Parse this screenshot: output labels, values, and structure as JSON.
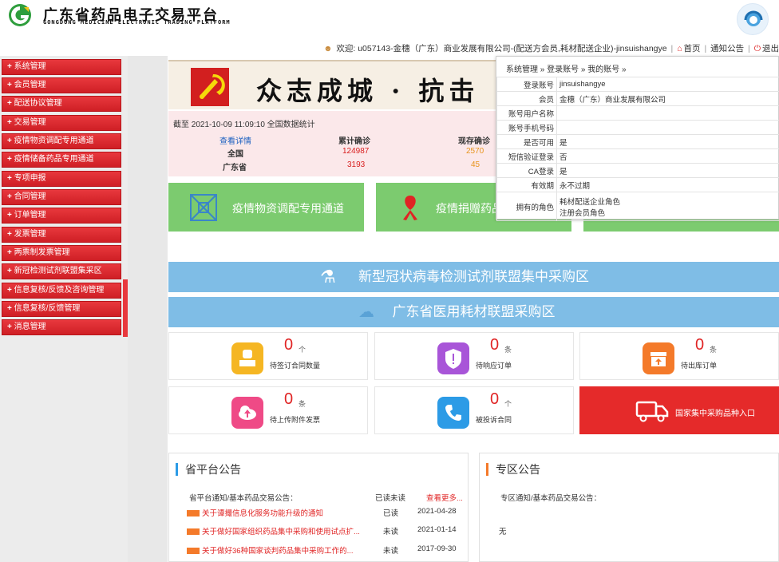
{
  "header": {
    "title": "广东省药品电子交易平台",
    "subtitle": "GONGDONG MEDICINE ELECTRONIC TRADING PLATFORM",
    "welcome": "欢迎: u057143-金穗（广东）商业发展有限公司-(配送方会员,耗材配送企业)-jinsuishangye",
    "home": "首页",
    "notice": "通知公告",
    "logout": "退出"
  },
  "sidebar": {
    "items": [
      {
        "label": "系统管理"
      },
      {
        "label": "会员管理"
      },
      {
        "label": "配送协议管理"
      },
      {
        "label": "交易管理"
      },
      {
        "label": "疫情物资调配专用通道"
      },
      {
        "label": "疫情储备药品专用通道"
      },
      {
        "label": "专项申报"
      },
      {
        "label": "合同管理"
      },
      {
        "label": "订单管理"
      },
      {
        "label": "发票管理"
      },
      {
        "label": "两票制发票管理"
      },
      {
        "label": "新冠检测试剂联盟集采区"
      },
      {
        "label": "信息复核/反馈及咨询管理"
      },
      {
        "label": "信息复核/反馈管理"
      },
      {
        "label": "消息管理"
      }
    ]
  },
  "banner": {
    "text": "众志成城 · 抗击"
  },
  "stats": {
    "as_of": "截至 2021-10-09 11:09:10 全国数据统计",
    "detail_link": "查看详情",
    "col_cumulative": "累计确诊",
    "col_current": "现存确诊",
    "rows": [
      {
        "region": "全国",
        "cumulative": "124987",
        "current": "2570"
      },
      {
        "region": "广东省",
        "cumulative": "3193",
        "current": "45"
      }
    ]
  },
  "quick": {
    "card1": "疫情物资调配专用通道",
    "card2": "疫情捐赠药品"
  },
  "zones": {
    "zone1": "新型冠状病毒检测试剂联盟集中采购区",
    "zone2": "广东省医用耗材联盟采购区"
  },
  "counters": [
    {
      "value": "0",
      "unit": "个",
      "caption": "待签订合同数量",
      "color": "#f5b623"
    },
    {
      "value": "0",
      "unit": "条",
      "caption": "待响应订单",
      "color": "#a855d8"
    },
    {
      "value": "0",
      "unit": "条",
      "caption": "待出库订单",
      "color": "#f47a2a"
    },
    {
      "value": "0",
      "unit": "条",
      "caption": "待上传附件发票",
      "color": "#ef4a86"
    },
    {
      "value": "0",
      "unit": "个",
      "caption": "被投诉合同",
      "color": "#2c9be6"
    }
  ],
  "national_entry": "国家集中采购品种入口",
  "province_notice": {
    "title": "省平台公告",
    "category": "省平台通知/基本药品交易公告：",
    "read_header": "已读未读",
    "more": "查看更多...",
    "items": [
      {
        "title": "关于谭撮信息化服务功能升级的通知",
        "status": "已读",
        "date": "2021-04-28"
      },
      {
        "title": "关于做好国家组织药品集中采购和使用试点扩...",
        "status": "未读",
        "date": "2021-01-14"
      },
      {
        "title": "关于做好36种国家谈判药品集中采购工作的...",
        "status": "未读",
        "date": "2017-09-30"
      }
    ]
  },
  "zone_notice": {
    "title": "专区公告",
    "category": "专区通知/基本药品交易公告：",
    "empty": "无"
  },
  "popup": {
    "crumb": "系统管理 » 登录账号 » 我的账号 »",
    "fields": [
      {
        "k": "登录账号",
        "v": "jinsuishangye"
      },
      {
        "k": "会员",
        "v": "金穗（广东）商业发展有限公司"
      },
      {
        "k": "账号用户名称",
        "v": ""
      },
      {
        "k": "账号手机号码",
        "v": ""
      },
      {
        "k": "是否可用",
        "v": "是"
      },
      {
        "k": "短信验证登录",
        "v": "否"
      },
      {
        "k": "CA登录",
        "v": "是"
      },
      {
        "k": "有效期",
        "v": "永不过期"
      }
    ],
    "roles_label": "拥有的角色",
    "roles": [
      "耗材配送企业角色",
      "注册会员角色"
    ]
  },
  "colors": {
    "brand_red": "#e8383d",
    "green_card": "#7ccb6f",
    "blue_bar": "#7fbde6",
    "alert_red": "#e02424"
  }
}
